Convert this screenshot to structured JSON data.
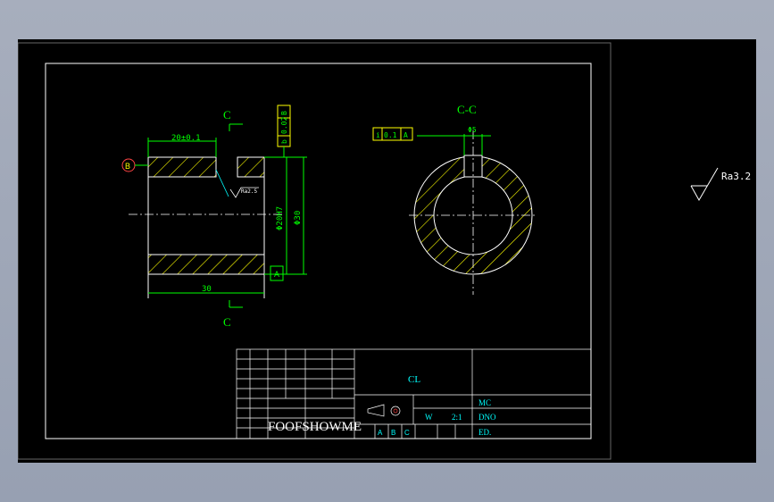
{
  "colors": {
    "background_window": "#a3abbb",
    "canvas": "#000000",
    "border": "#ffffff",
    "dimension": "#00ff00",
    "geometry": "#ffffff",
    "hatch": "#ffff00",
    "symbol_box": "#ffff00",
    "datum": "#ff4444",
    "title_text": "#00ffff"
  },
  "section_marks": {
    "top": "C",
    "bottom": "C"
  },
  "section_title": "C-C",
  "dimensions": {
    "width_top": "20±0.1",
    "length": "30",
    "inner_dia": "Φ20H7",
    "outer_dia": "Φ30",
    "slot": "Φ5"
  },
  "gdt": {
    "parallel": {
      "symbol": "b",
      "tol": "0.02",
      "datum": "B"
    },
    "position": {
      "symbol": "i",
      "tol": "0.1",
      "datum": "A"
    }
  },
  "datums": {
    "left": "B",
    "bottom": "A"
  },
  "roughness": {
    "local": "Ra2.5",
    "general": "Ra3.2"
  },
  "title_block": {
    "name": "CL",
    "material_label": "MC",
    "drawing_no": "DNO",
    "scale": "2:1",
    "weight_label": "W",
    "ed": "ED.",
    "watermark": "FOOFSHOWME",
    "table_labels": [
      "A",
      "B",
      "C"
    ]
  }
}
